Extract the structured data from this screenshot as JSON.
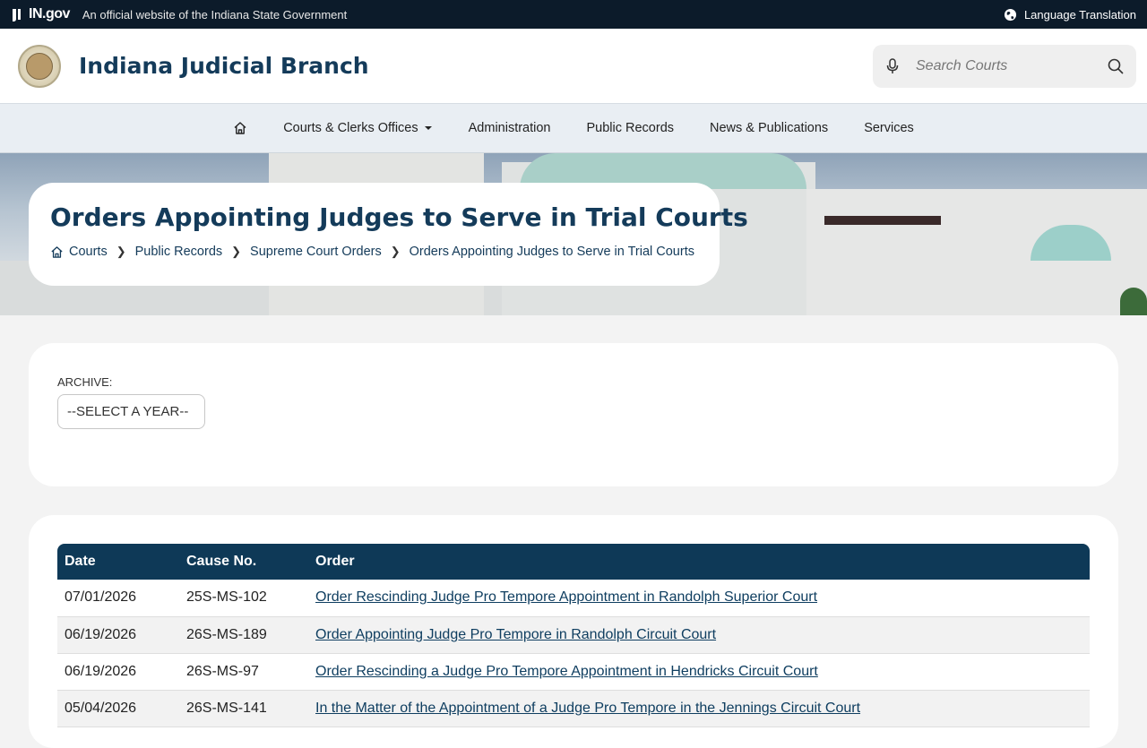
{
  "topbar": {
    "logo_text": "IN.gov",
    "official_text": "An official website of the Indiana State Government",
    "language_label": "Language Translation"
  },
  "header": {
    "site_name": "Indiana Judicial Branch",
    "search_placeholder": "Search Courts"
  },
  "nav": {
    "items": [
      {
        "label": "Courts & Clerks Offices",
        "has_dropdown": true
      },
      {
        "label": "Administration"
      },
      {
        "label": "Public Records"
      },
      {
        "label": "News & Publications"
      },
      {
        "label": "Services"
      }
    ]
  },
  "hero": {
    "title": "Orders Appointing Judges to Serve in Trial Courts",
    "breadcrumb": [
      "Courts",
      "Public Records",
      "Supreme Court Orders",
      "Orders Appointing Judges to Serve in Trial Courts"
    ]
  },
  "archive": {
    "label": "ARCHIVE:",
    "select_value": "--SELECT A YEAR--"
  },
  "table": {
    "headers": [
      "Date",
      "Cause No.",
      "Order"
    ],
    "rows": [
      {
        "date": "07/01/2026",
        "cause": "25S-MS-102",
        "order": "Order Rescinding Judge Pro Tempore Appointment in Randolph Superior Court"
      },
      {
        "date": "06/19/2026",
        "cause": "26S-MS-189",
        "order": "Order Appointing Judge Pro Tempore in Randolph Circuit Court"
      },
      {
        "date": "06/19/2026",
        "cause": "26S-MS-97",
        "order": "Order Rescinding a Judge Pro Tempore Appointment in Hendricks Circuit Court"
      },
      {
        "date": "05/04/2026",
        "cause": "26S-MS-141",
        "order": "In the Matter of the Appointment of a Judge Pro Tempore in the Jennings Circuit Court"
      }
    ]
  },
  "colors": {
    "topbar": "#0c1b2a",
    "brand": "#143b5a",
    "table_header": "#0e3957",
    "link": "#0f3e60"
  }
}
